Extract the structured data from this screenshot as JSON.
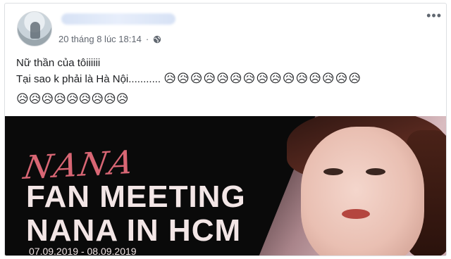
{
  "post": {
    "timestamp": "20 tháng 8 lúc 18:14",
    "more_label": "•••",
    "text_line1": "Nữ thần của tôiiiiii",
    "text_line2": "Tại sao k phải là Hà Nội...........",
    "emoji_inline": "😥😥😥😥😥😥😥😥😥😥😥😥😥😥😥",
    "emoji_line": "😥😥😥😥😥😥😥😥😥"
  },
  "banner": {
    "script_title": "NANA",
    "line1": "FAN MEETING",
    "line2": "NANA IN HCM",
    "dates": "07.09.2019 - 08.09.2019"
  },
  "colors": {
    "script_pink": "#e46b7a",
    "banner_bg": "#0a0a0a"
  },
  "icons": {
    "privacy": "globe-icon",
    "menu": "more-options-icon"
  }
}
